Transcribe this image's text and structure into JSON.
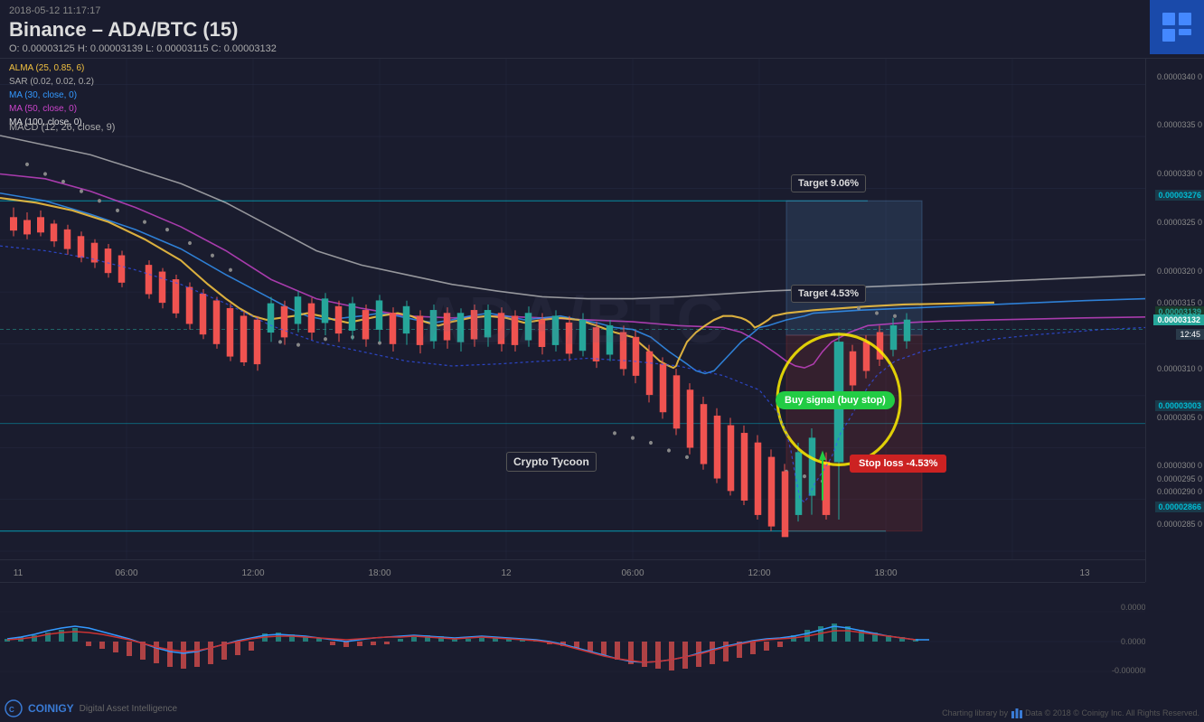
{
  "header": {
    "timestamp": "2018-05-12  11:17:17",
    "title": "Binance – ADA/BTC (15)",
    "ohlc": "O: 0.00003125  H: 0.00003139  L: 0.00003115  C: 0.00003132"
  },
  "indicators": {
    "alma": "ALMA (25, 0.85, 6)",
    "sar": "SAR (0.02, 0.02, 0.2)",
    "ma30": "MA (30, close, 0)",
    "ma50": "MA (50, close, 0)",
    "ma100": "MA (100, close, 0)"
  },
  "macd_label": "MACD (12, 26, close, 9)",
  "annotations": {
    "target1": "Target 9.06%",
    "target2": "Target 4.53%",
    "buy_signal": "Buy signal (buy stop)",
    "stop_loss": "Stop loss -4.53%",
    "crypto_tycoon": "Crypto Tycoon"
  },
  "price_levels": {
    "p3400": "0.0000340 0",
    "p3350": "0.0000335 0",
    "p3300": "0.0000330 0",
    "p3276": "0.00003276",
    "p3250": "0.0000325 0",
    "p3200": "0.0000320 0",
    "p3150": "0.0000315 0",
    "p3139": "0.00003139",
    "p3132": "0.00003132",
    "p3100": "0.0000310 0",
    "p3050": "0.0000305 0",
    "p3003": "0.00003003",
    "p3000": "0.0000300 0",
    "p2950": "0.0000295 0",
    "p2900": "0.0000290 0",
    "p2866": "0.00002866",
    "p2850": "0.0000285 0"
  },
  "time_labels": [
    "11",
    "06:00",
    "12:00",
    "18:00",
    "12",
    "06:00",
    "12:00",
    "18:00",
    "13"
  ],
  "footer": {
    "coinigy": "COINIGY",
    "coinigy_sub": "Digital Asset Intelligence",
    "tradingview": "Charting library by",
    "copyright": "Data © 2018  © Coinigy Inc. All Rights Reserved."
  },
  "colors": {
    "background": "#1a1c2e",
    "grid": "#252840",
    "up_candle": "#26a69a",
    "down_candle": "#ef5350",
    "alma": "#f0c040",
    "ma30": "#3399ff",
    "ma50": "#cc44cc",
    "ma100": "#cccccc",
    "sar_dots": "#aaaaaa",
    "target_zone": "rgba(100,160,200,0.25)",
    "stop_zone": "rgba(180,60,60,0.25)",
    "accent_blue": "#1a4aaa",
    "current_price": "#26a69a",
    "level_cyan": "#00bcd4"
  }
}
